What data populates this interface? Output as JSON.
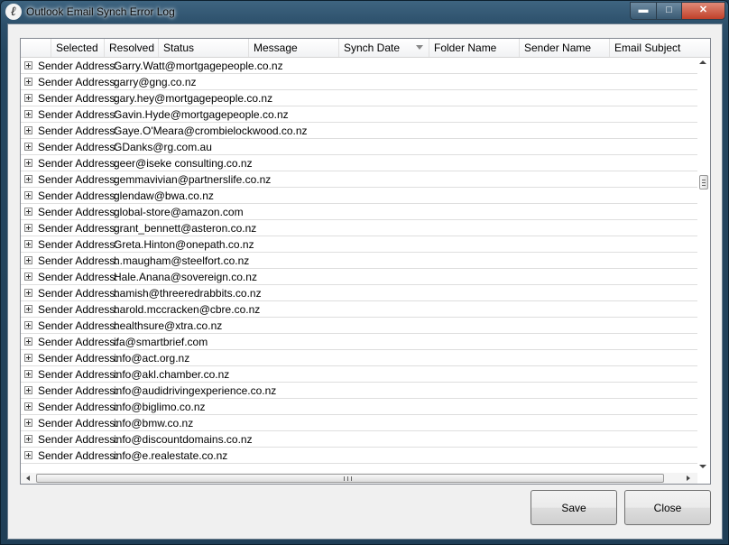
{
  "window": {
    "title": "Outlook Email Synch Error Log",
    "app_icon_glyph": "ℓ",
    "minimize_glyph": "▬",
    "maximize_glyph": "□",
    "close_glyph": "✕"
  },
  "grid": {
    "columns": [
      "Selected",
      "Resolved",
      "Status",
      "Message",
      "Synch Date",
      "Folder Name",
      "Sender Name",
      "Email Subject"
    ],
    "sorted_column": "Synch Date",
    "sort_direction": "descending",
    "group_label": "Sender Address:",
    "groups": [
      "Garry.Watt@mortgagepeople.co.nz",
      "garry@gng.co.nz",
      "gary.hey@mortgagepeople.co.nz",
      "Gavin.Hyde@mortgagepeople.co.nz",
      "Gaye.O'Meara@crombielockwood.co.nz",
      "GDanks@rg.com.au",
      "geer@iseke consulting.co.nz",
      "gemmavivian@partnerslife.co.nz",
      "glendaw@bwa.co.nz",
      "global-store@amazon.com",
      "grant_bennett@asteron.co.nz",
      "Greta.Hinton@onepath.co.nz",
      "h.maugham@steelfort.co.nz",
      "Hale.Anana@sovereign.co.nz",
      "hamish@threeredrabbits.co.nz",
      "harold.mccracken@cbre.co.nz",
      "healthsure@xtra.co.nz",
      "ifa@smartbrief.com",
      "info@act.org.nz",
      "info@akl.chamber.co.nz",
      "info@audidrivingexperience.co.nz",
      "info@biglimo.co.nz",
      "info@bmw.co.nz",
      "info@discountdomains.co.nz",
      "info@e.realestate.co.nz"
    ]
  },
  "buttons": {
    "save": "Save",
    "close": "Close"
  }
}
